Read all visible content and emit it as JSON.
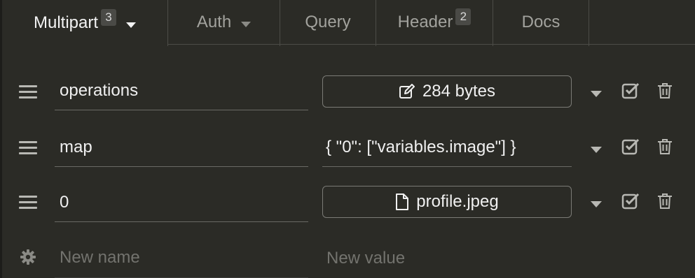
{
  "tabs": [
    {
      "label": "Multipart",
      "badge": "3",
      "active": true
    },
    {
      "label": "Auth"
    },
    {
      "label": "Query"
    },
    {
      "label": "Header",
      "badge": "2"
    },
    {
      "label": "Docs"
    }
  ],
  "rows": [
    {
      "name": "operations",
      "value": "284 bytes",
      "value_kind": "text-editor",
      "icon": "edit-icon"
    },
    {
      "name": "map",
      "value": "{ \"0\": [\"variables.image\"] }",
      "value_kind": "inline"
    },
    {
      "name": "0",
      "value": "profile.jpeg",
      "value_kind": "file",
      "icon": "file-icon"
    }
  ],
  "new_row": {
    "name_placeholder": "New name",
    "value_placeholder": "New value"
  },
  "colors": {
    "background": "#2b2b26",
    "border": "#4c4c47",
    "text": "#ececec",
    "muted": "#a2a29d"
  }
}
